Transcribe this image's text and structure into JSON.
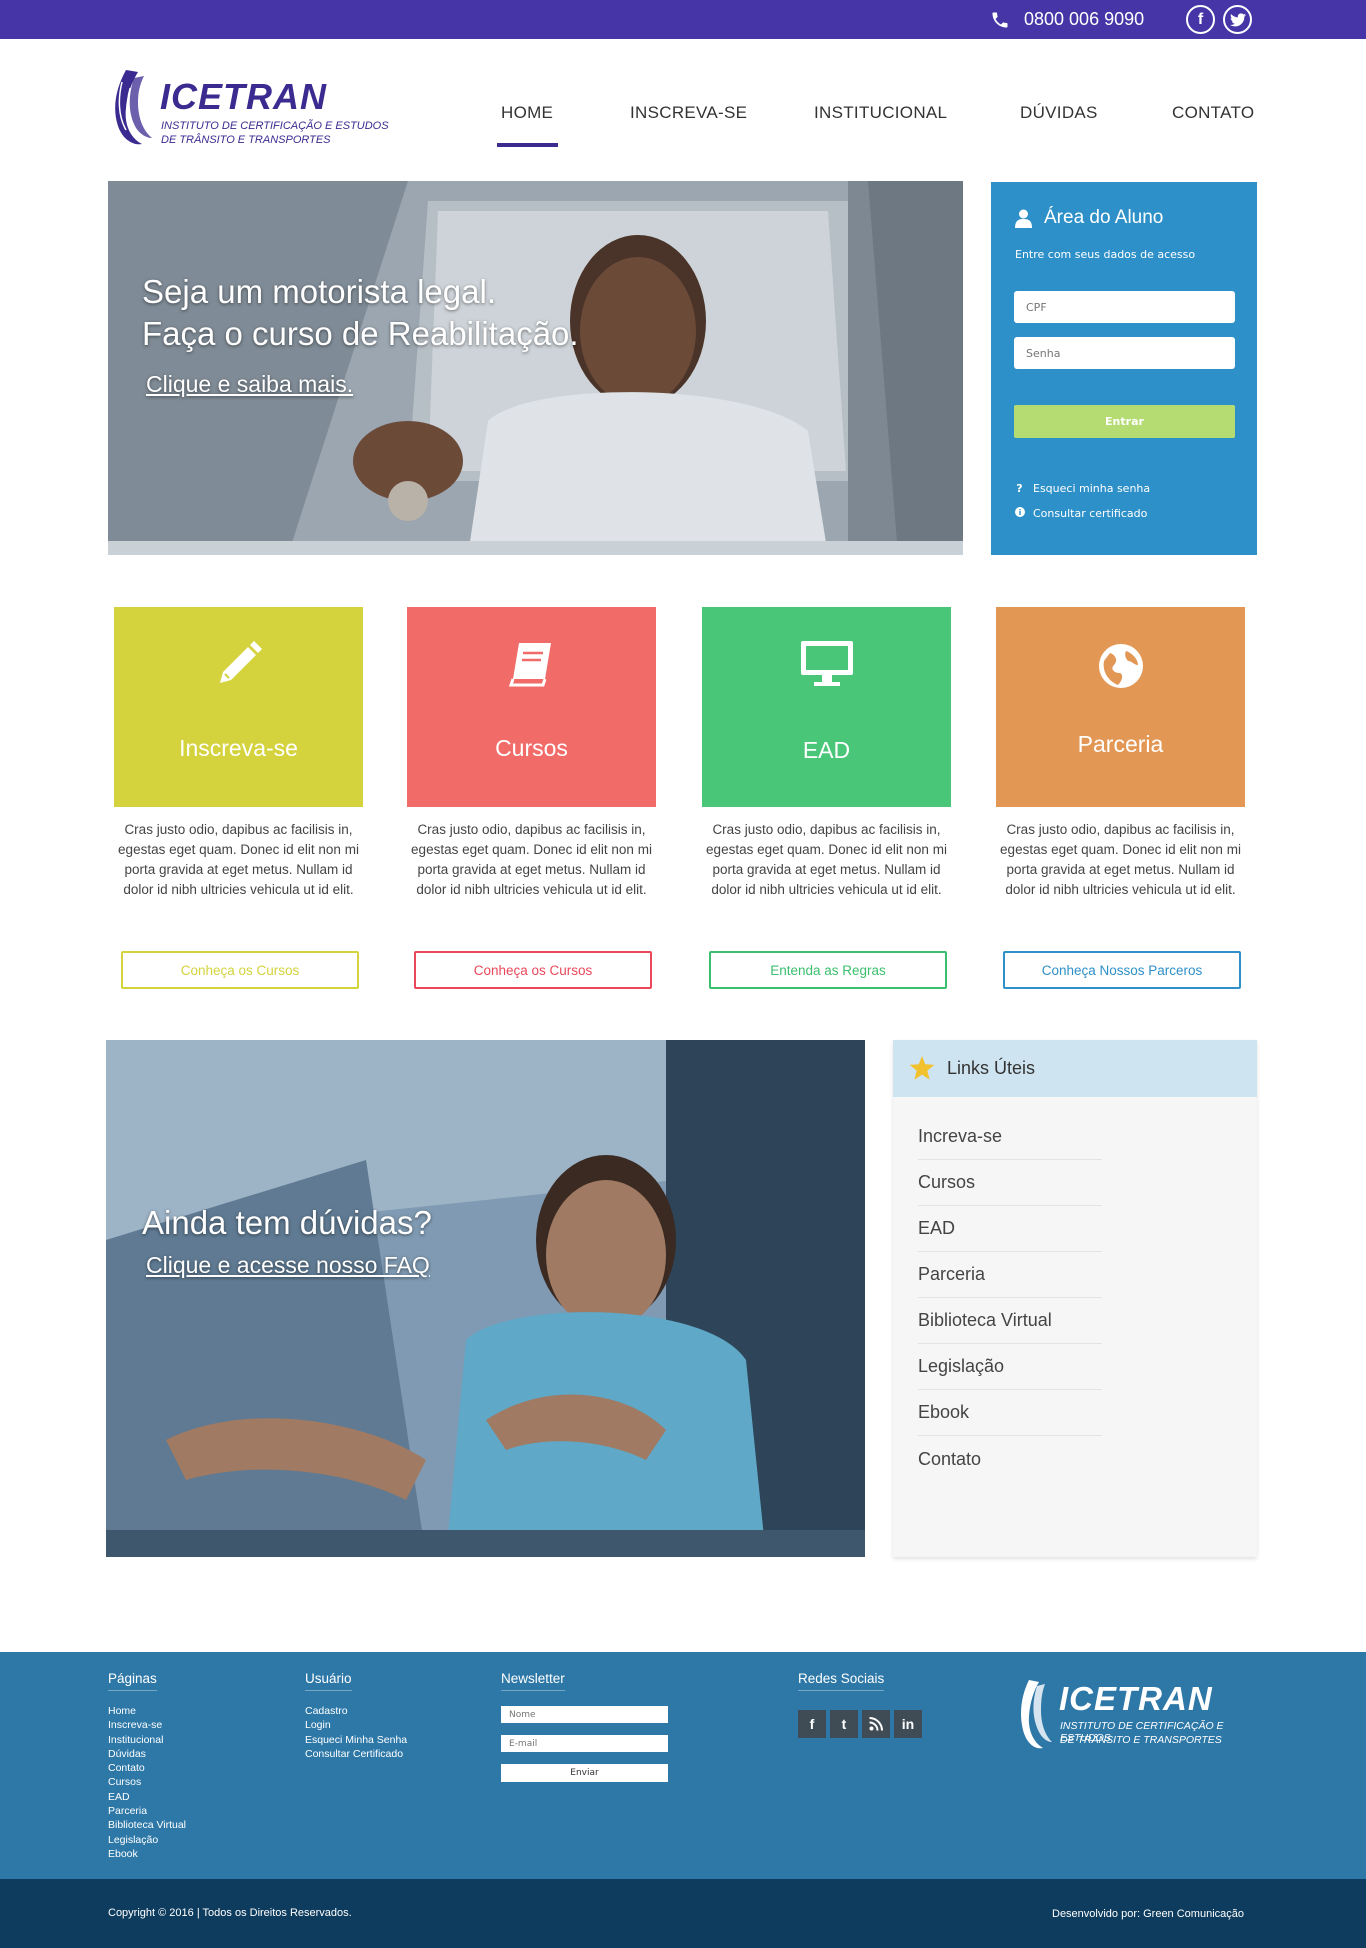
{
  "topbar": {
    "phone": "0800 006 9090",
    "social": [
      {
        "icon": "facebook-icon",
        "glyph": "f"
      },
      {
        "icon": "twitter-icon",
        "glyph": "t"
      }
    ]
  },
  "logo": {
    "brand": "ICETRAN",
    "line1": "INSTITUTO DE CERTIFICAÇÃO E ESTUDOS",
    "line2": "DE TRÂNSITO E TRANSPORTES"
  },
  "nav": {
    "items": [
      "HOME",
      "INSCREVA-SE",
      "INSTITUCIONAL",
      "DÚVIDAS",
      "CONTATO"
    ],
    "active": "HOME"
  },
  "hero": {
    "title_line1": "Seja um motorista legal.",
    "title_line2": "Faça o curso de Reabilitação.",
    "link": "Clique e saiba mais."
  },
  "aluno": {
    "title": "Área do Aluno",
    "subtitle": "Entre com seus dados de acesso",
    "cpf_placeholder": "CPF",
    "senha_placeholder": "Senha",
    "submit": "Entrar",
    "forgot": "Esqueci minha senha",
    "certificate": "Consultar certificado"
  },
  "cards": [
    {
      "label": "Inscreva-se",
      "icon": "pencil-icon",
      "color": "#d4d33d",
      "button": "Conheça os Cursos",
      "button_color": "#d4d33d",
      "desc": "Cras justo odio, dapibus ac facilisis in, egestas eget quam. Donec id elit non mi porta gravida at eget metus. Nullam id dolor id nibh ultricies vehicula ut id elit."
    },
    {
      "label": "Cursos",
      "icon": "book-icon",
      "color": "#f16b69",
      "button": "Conheça os Cursos",
      "button_color": "#e9485a",
      "desc": "Cras justo odio, dapibus ac facilisis in, egestas eget quam. Donec id elit non mi porta gravida at eget metus. Nullam id dolor id nibh ultricies vehicula ut id elit."
    },
    {
      "label": "EAD",
      "icon": "monitor-icon",
      "color": "#4ac679",
      "button": "Entenda as Regras",
      "button_color": "#3bbf6e",
      "desc": "Cras justo odio, dapibus ac facilisis in, egestas eget quam. Donec id elit non mi porta gravida at eget metus. Nullam id dolor id nibh ultricies vehicula ut id elit."
    },
    {
      "label": "Parceria",
      "icon": "globe-icon",
      "color": "#e39755",
      "button": "Conheça Nossos Parceros",
      "button_color": "#2e90c8",
      "desc": "Cras justo odio, dapibus ac facilisis in, egestas eget quam. Donec id elit non mi porta gravida at eget metus. Nullam id dolor id nibh ultricies vehicula ut id elit."
    }
  ],
  "faq": {
    "title": "Ainda tem dúvidas?",
    "link": "Clique e acesse nosso FAQ"
  },
  "links": {
    "title": "Links Úteis",
    "items": [
      "Increva-se",
      "Cursos",
      "EAD",
      "Parceria",
      "Biblioteca Virtual",
      "Legislação",
      "Ebook",
      "Contato"
    ]
  },
  "footer": {
    "pages_title": "Páginas",
    "pages": [
      "Home",
      "Inscreva-se",
      "Institucional",
      "Dúvidas",
      "Contato",
      "Cursos",
      "EAD",
      "Parceria",
      "Biblioteca Virtual",
      "Legislação",
      "Ebook"
    ],
    "user_title": "Usuário",
    "user": [
      "Cadastro",
      "Login",
      "Esqueci Minha Senha",
      "Consultar Certificado"
    ],
    "newsletter_title": "Newsletter",
    "name_placeholder": "Nome",
    "email_placeholder": "E-mail",
    "send": "Enviar",
    "social_title": "Redes Sociais",
    "social": [
      {
        "icon": "facebook-icon",
        "glyph": "f"
      },
      {
        "icon": "tumblr-icon",
        "glyph": "t"
      },
      {
        "icon": "rss-icon",
        "glyph": ""
      },
      {
        "icon": "linkedin-icon",
        "glyph": "in"
      }
    ],
    "copyright": "Copyright © 2016 | Todos os Direitos Reservados.",
    "developer": "Desenvolvido por: Green Comunicação"
  }
}
